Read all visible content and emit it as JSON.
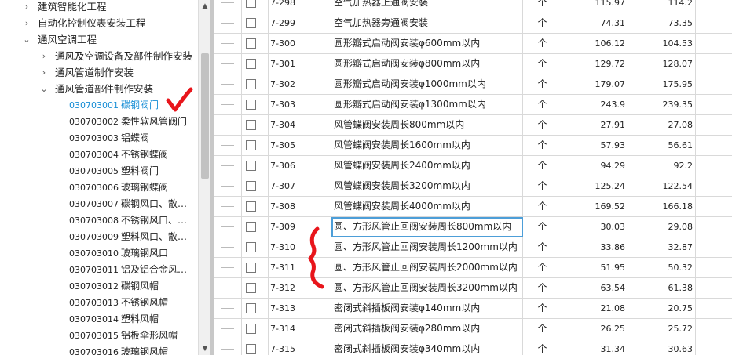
{
  "tree": {
    "items": [
      {
        "arrow": "›",
        "label": "建筑智能化工程",
        "level": 0
      },
      {
        "arrow": "›",
        "label": "自动化控制仪表安装工程",
        "level": 0
      },
      {
        "arrow": "⌄",
        "label": "通风空调工程",
        "level": 0
      },
      {
        "arrow": "›",
        "label": "通风及空调设备及部件制作安装",
        "level": 1
      },
      {
        "arrow": "›",
        "label": "通风管道制作安装",
        "level": 1
      },
      {
        "arrow": "⌄",
        "label": "通风管道部件制作安装",
        "level": 1
      }
    ],
    "leaves": [
      {
        "code": "030703001",
        "name": "碳钢阀门",
        "selected": true
      },
      {
        "code": "030703002",
        "name": "柔性软风管阀门"
      },
      {
        "code": "030703003",
        "name": "铝蝶阀"
      },
      {
        "code": "030703004",
        "name": "不锈钢蝶阀"
      },
      {
        "code": "030703005",
        "name": "塑料阀门"
      },
      {
        "code": "030703006",
        "name": "玻璃钢蝶阀"
      },
      {
        "code": "030703007",
        "name": "碳钢风口、散…"
      },
      {
        "code": "030703008",
        "name": "不锈钢风口、…"
      },
      {
        "code": "030703009",
        "name": "塑料风口、散…"
      },
      {
        "code": "030703010",
        "name": "玻璃钢风口"
      },
      {
        "code": "030703011",
        "name": "铝及铝合金风…"
      },
      {
        "code": "030703012",
        "name": "碳钢风帽"
      },
      {
        "code": "030703013",
        "name": "不锈钢风帽"
      },
      {
        "code": "030703014",
        "name": "塑料风帽"
      },
      {
        "code": "030703015",
        "name": "铝板伞形风帽"
      },
      {
        "code": "030703016",
        "name": "玻璃钢风帽"
      }
    ]
  },
  "grid": {
    "rows": [
      {
        "code": "7-298",
        "name": "空气加热器上通阀安装",
        "unit": "个",
        "v1": "115.97",
        "v2": "114.2"
      },
      {
        "code": "7-299",
        "name": "空气加热器旁通阀安装",
        "unit": "个",
        "v1": "74.31",
        "v2": "73.35"
      },
      {
        "code": "7-300",
        "name": "圆形瓣式启动阀安装φ600mm以内",
        "unit": "个",
        "v1": "106.12",
        "v2": "104.53"
      },
      {
        "code": "7-301",
        "name": "圆形瓣式启动阀安装φ800mm以内",
        "unit": "个",
        "v1": "129.72",
        "v2": "128.07"
      },
      {
        "code": "7-302",
        "name": "圆形瓣式启动阀安装φ1000mm以内",
        "unit": "个",
        "v1": "179.07",
        "v2": "175.95"
      },
      {
        "code": "7-303",
        "name": "圆形瓣式启动阀安装φ1300mm以内",
        "unit": "个",
        "v1": "243.9",
        "v2": "239.35"
      },
      {
        "code": "7-304",
        "name": "风管蝶阀安装周长800mm以内",
        "unit": "个",
        "v1": "27.91",
        "v2": "27.08"
      },
      {
        "code": "7-305",
        "name": "风管蝶阀安装周长1600mm以内",
        "unit": "个",
        "v1": "57.93",
        "v2": "56.61"
      },
      {
        "code": "7-306",
        "name": "风管蝶阀安装周长2400mm以内",
        "unit": "个",
        "v1": "94.29",
        "v2": "92.2"
      },
      {
        "code": "7-307",
        "name": "风管蝶阀安装周长3200mm以内",
        "unit": "个",
        "v1": "125.24",
        "v2": "122.54"
      },
      {
        "code": "7-308",
        "name": "风管蝶阀安装周长4000mm以内",
        "unit": "个",
        "v1": "169.52",
        "v2": "166.18"
      },
      {
        "code": "7-309",
        "name": "圆、方形风管止回阀安装周长800mm以内",
        "unit": "个",
        "v1": "30.03",
        "v2": "29.08",
        "focused": true
      },
      {
        "code": "7-310",
        "name": "圆、方形风管止回阀安装周长1200mm以内",
        "unit": "个",
        "v1": "33.86",
        "v2": "32.87"
      },
      {
        "code": "7-311",
        "name": "圆、方形风管止回阀安装周长2000mm以内",
        "unit": "个",
        "v1": "51.95",
        "v2": "50.32"
      },
      {
        "code": "7-312",
        "name": "圆、方形风管止回阀安装周长3200mm以内",
        "unit": "个",
        "v1": "63.54",
        "v2": "61.38"
      },
      {
        "code": "7-313",
        "name": "密闭式斜插板阀安装φ140mm以内",
        "unit": "个",
        "v1": "21.08",
        "v2": "20.75"
      },
      {
        "code": "7-314",
        "name": "密闭式斜插板阀安装φ280mm以内",
        "unit": "个",
        "v1": "26.25",
        "v2": "25.72"
      },
      {
        "code": "7-315",
        "name": "密闭式斜插板阀安装φ340mm以内",
        "unit": "个",
        "v1": "31.34",
        "v2": "30.63"
      }
    ]
  },
  "icons": {
    "scroll_up": "scroll-up-arrow-icon",
    "scroll_down": "scroll-down-arrow-icon",
    "row_checkbox": "checkbox-icon"
  },
  "colors": {
    "selected_text": "#1a8fd6",
    "annotation_red": "#e8151b",
    "focus_border": "#4d9ed8"
  }
}
